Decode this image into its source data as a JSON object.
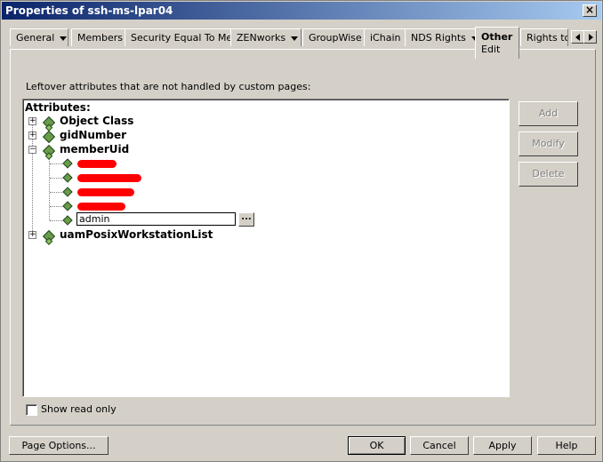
{
  "window": {
    "title": "Properties of ssh-ms-lpar04"
  },
  "tabs": [
    {
      "label": "General"
    },
    {
      "label": "Members"
    },
    {
      "label": "Security Equal To Me"
    },
    {
      "label": "ZENworks"
    },
    {
      "label": "GroupWise"
    },
    {
      "label": "iChain"
    },
    {
      "label": "NDS Rights"
    },
    {
      "label": "Other",
      "sub": "Edit"
    },
    {
      "label": "Rights to"
    }
  ],
  "panel": {
    "leftover_label": "Leftover attributes that are not handled by custom pages:",
    "tree_header": "Attributes:",
    "attributes": [
      {
        "name": "Object Class"
      },
      {
        "name": "gidNumber"
      },
      {
        "name": "memberUid"
      },
      {
        "name": "uamPosixWorkstationList"
      }
    ],
    "member_edit_value": "admin",
    "ellipsis": "..."
  },
  "side_buttons": {
    "add": "Add",
    "modify": "Modify",
    "delete": "Delete"
  },
  "show_read_only": "Show read only",
  "footer": {
    "page_options": "Page Options...",
    "ok": "OK",
    "cancel": "Cancel",
    "apply": "Apply",
    "help": "Help"
  },
  "icons": {
    "close": "close-icon",
    "expander": "tree-expander-icon",
    "attribute": "attribute-icon",
    "value": "value-icon"
  },
  "colors": {
    "titlebar_start": "#0a246a",
    "titlebar_end": "#a6caf0",
    "redaction": "#ff0000"
  }
}
